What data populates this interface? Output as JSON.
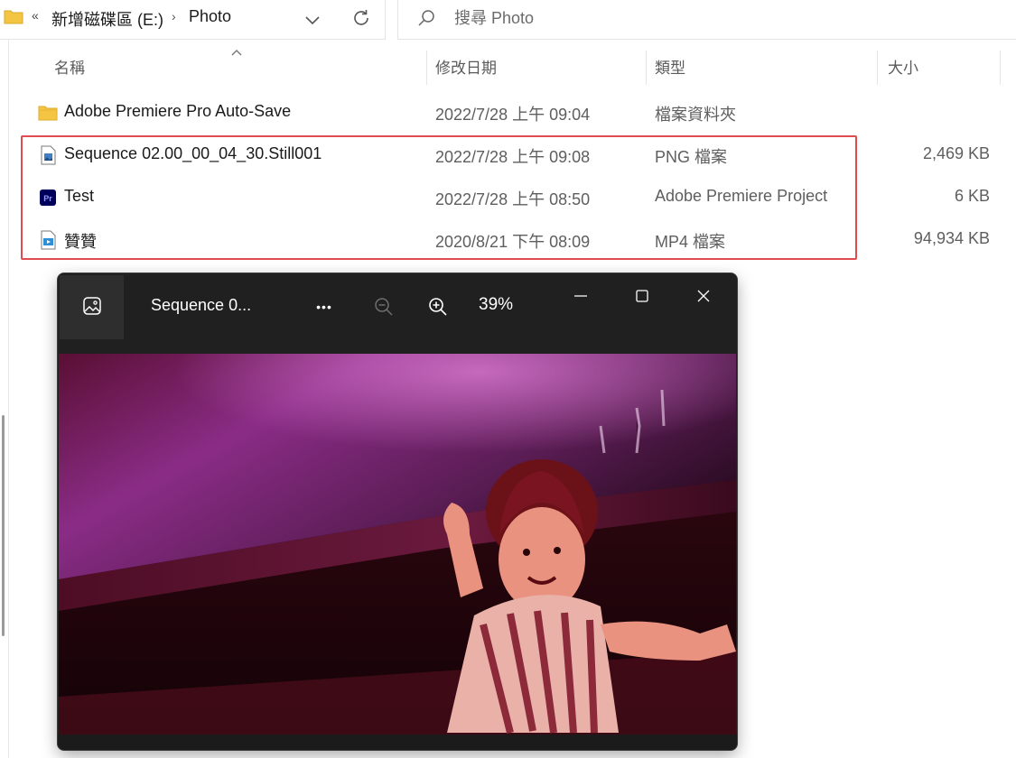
{
  "address": {
    "more": "«",
    "breadcrumbs": [
      "新增磁碟區 (E:)",
      "Photo"
    ],
    "separator": "›"
  },
  "search": {
    "placeholder": "搜尋 Photo"
  },
  "columns": {
    "name": "名稱",
    "date": "修改日期",
    "type": "類型",
    "size": "大小"
  },
  "files": [
    {
      "name": "Adobe Premiere Pro Auto-Save",
      "date": "2022/7/28 上午 09:04",
      "type": "檔案資料夾",
      "size": "",
      "icon": "folder-icon"
    },
    {
      "name": "Sequence 02.00_00_04_30.Still001",
      "date": "2022/7/28 上午 09:08",
      "type": "PNG 檔案",
      "size": "2,469 KB",
      "icon": "png-file-icon"
    },
    {
      "name": "Test",
      "date": "2022/7/28 上午 08:50",
      "type": "Adobe Premiere Project",
      "size": "6 KB",
      "icon": "premiere-project-icon"
    },
    {
      "name": "贊贊",
      "date": "2020/8/21 下午 08:09",
      "type": "MP4 檔案",
      "size": "94,934 KB",
      "icon": "mp4-file-icon"
    }
  ],
  "viewer": {
    "title": "Sequence 0...",
    "zoom": "39%",
    "more": "•••",
    "premiere_badge": "Pr"
  },
  "colors": {
    "highlight": "#e04b4f",
    "viewer_bg": "#202020",
    "folder": "#f4c542"
  }
}
